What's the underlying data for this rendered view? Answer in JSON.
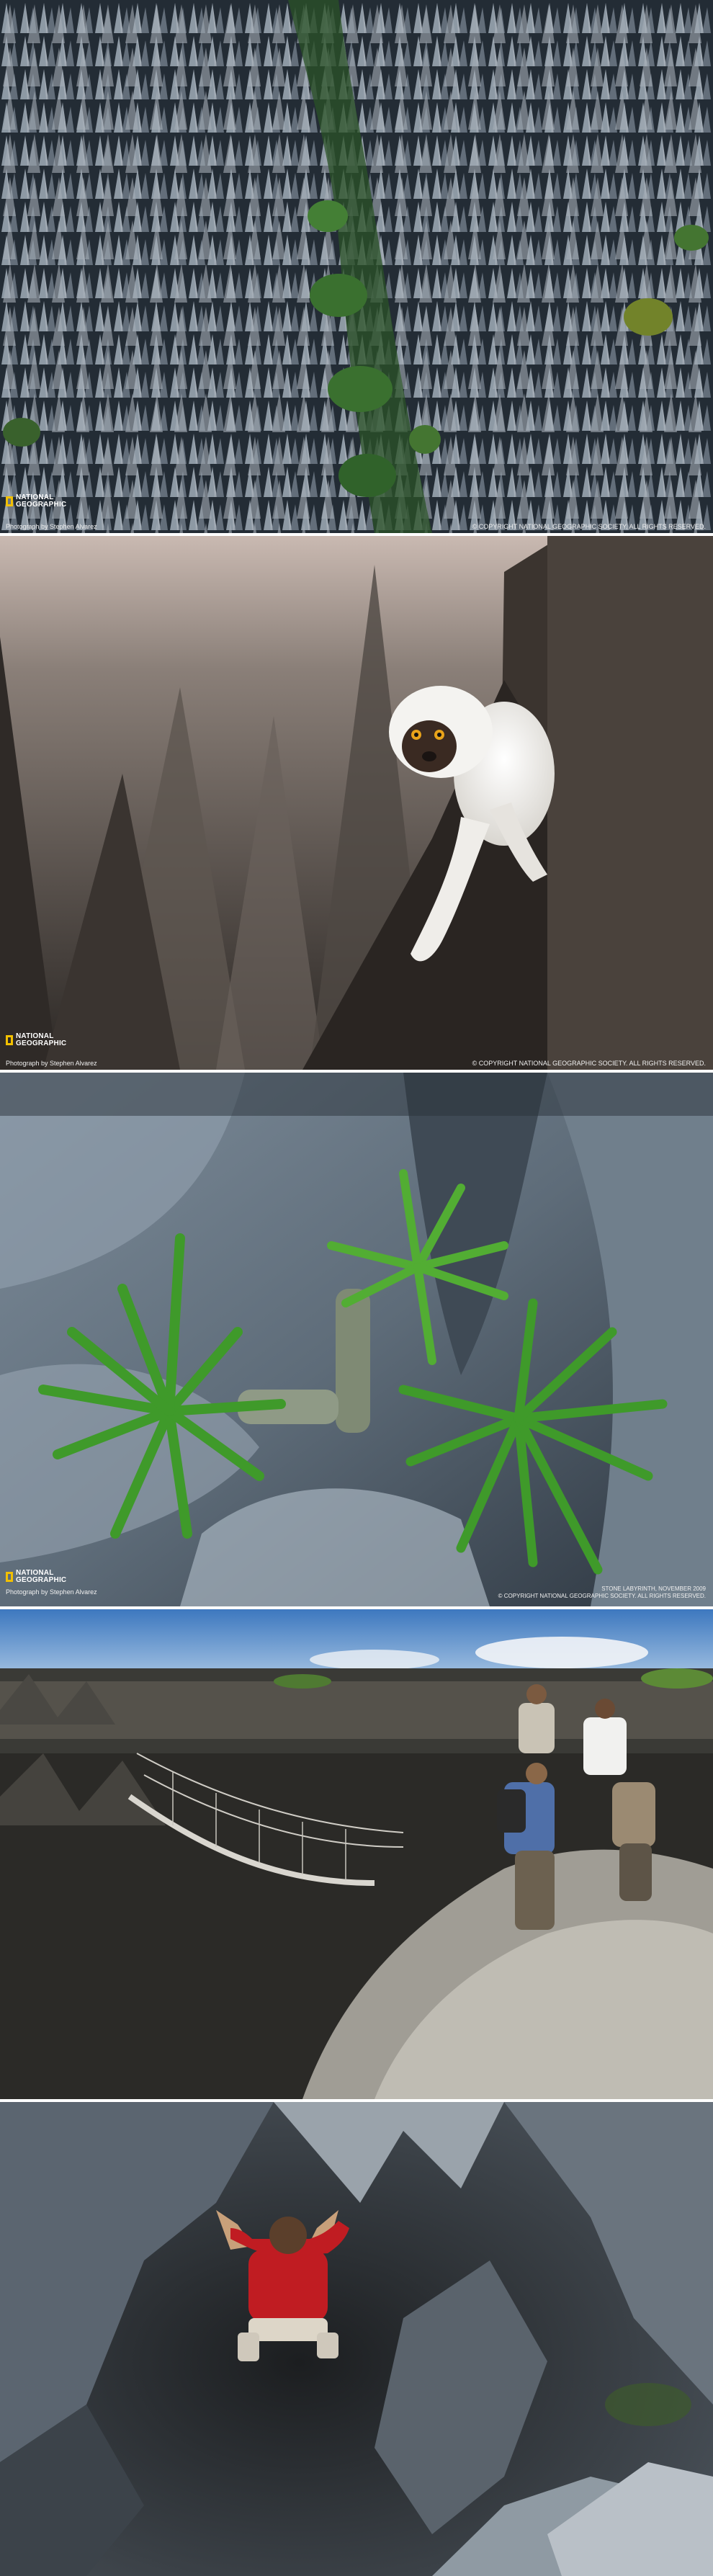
{
  "panels": [
    {
      "logo_text": "NATIONAL GEOGRAPHIC",
      "credit_left": "Photograph by Stephen Alvarez",
      "credit_right": "© COPYRIGHT NATIONAL GEOGRAPHIC SOCIETY.  ALL RIGHTS RESERVED."
    },
    {
      "logo_text": "NATIONAL GEOGRAPHIC",
      "credit_left": "Photograph by Stephen Alvarez",
      "credit_right": "© COPYRIGHT NATIONAL GEOGRAPHIC SOCIETY.  ALL RIGHTS RESERVED."
    },
    {
      "logo_text": "NATIONAL GEOGRAPHIC",
      "credit_left": "Photograph by Stephen Alvarez",
      "credit_right_line1": "STONE LABYRINTH, NOVEMBER 2009",
      "credit_right": "© COPYRIGHT NATIONAL GEOGRAPHIC SOCIETY.  ALL RIGHTS RESERVED."
    }
  ],
  "colors": {
    "logo_yellow": "#f2c000",
    "stone_gray": "#6f7c8a",
    "leaf_green": "#4e9a28",
    "jacket_red": "#c01c22"
  },
  "icons": [
    "national-geographic-logo-icon"
  ]
}
